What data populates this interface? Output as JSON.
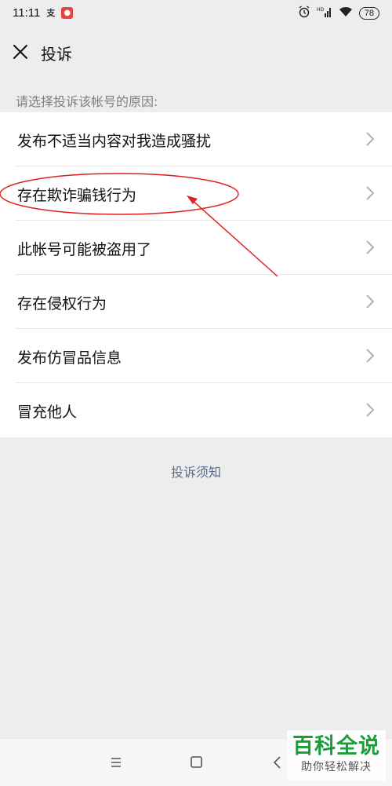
{
  "status_bar": {
    "time": "11:11",
    "battery": "78",
    "app_icons": [
      "alipay-icon",
      "app-notification-icon"
    ],
    "right_icons": [
      "alarm-icon",
      "hd-signal-icon",
      "wifi-icon",
      "battery-icon"
    ]
  },
  "header": {
    "title": "投诉",
    "close_icon": "close-icon"
  },
  "prompt": "请选择投诉该帐号的原因:",
  "reasons": [
    {
      "label": "发布不适当内容对我造成骚扰"
    },
    {
      "label": "存在欺诈骗钱行为"
    },
    {
      "label": "此帐号可能被盗用了"
    },
    {
      "label": "存在侵权行为"
    },
    {
      "label": "发布仿冒品信息"
    },
    {
      "label": "冒充他人"
    }
  ],
  "notice_link": "投诉须知",
  "annotation": {
    "highlighted_item": "存在欺诈骗钱行为",
    "color": "#e02020"
  },
  "nav_bar": {
    "icons": [
      "menu-icon",
      "home-icon",
      "back-icon"
    ]
  },
  "watermark": {
    "title": "百科全说",
    "subtitle": "助你轻松解决"
  },
  "colors": {
    "background": "#ededed",
    "link": "#576b95",
    "watermark_green": "#1a9e3a"
  }
}
